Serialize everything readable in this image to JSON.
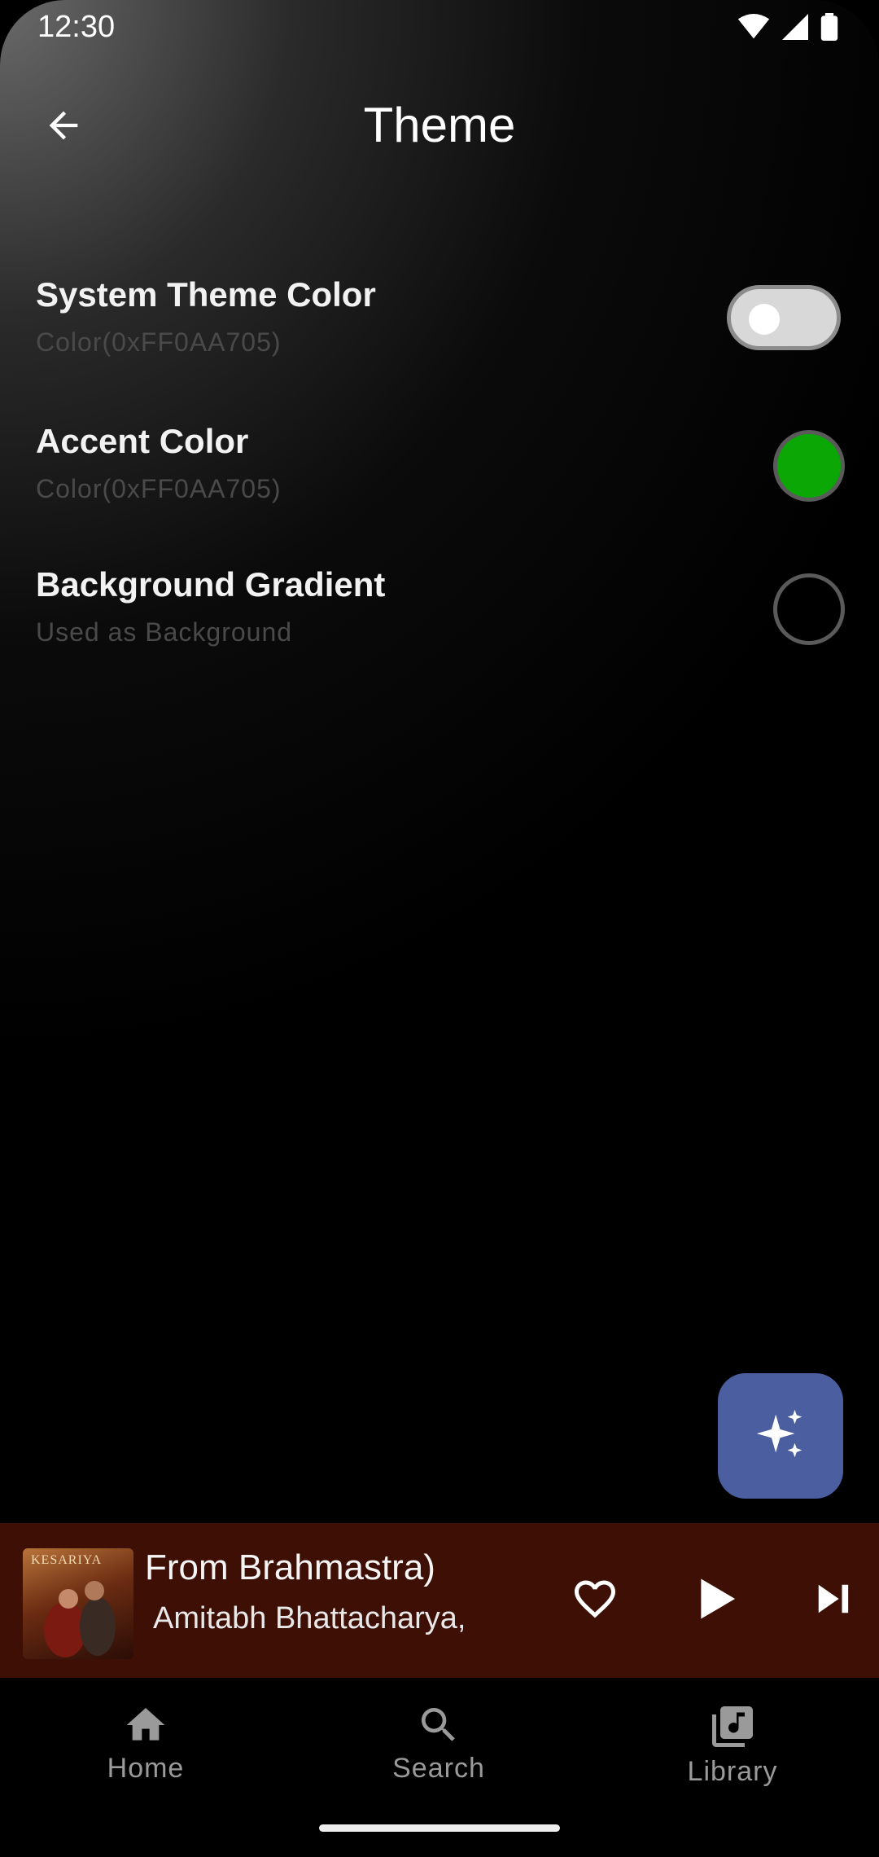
{
  "status_bar": {
    "time": "12:30"
  },
  "header": {
    "title": "Theme"
  },
  "settings": [
    {
      "title": "System Theme Color",
      "subtitle": "Color(0xFF0AA705)",
      "control": "toggle",
      "enabled": false
    },
    {
      "title": "Accent Color",
      "subtitle": "Color(0xFF0AA705)",
      "control": "color-swatch",
      "color": "#0aa705"
    },
    {
      "title": "Background Gradient",
      "subtitle": "Used as Background",
      "control": "color-swatch",
      "color": "transparent"
    }
  ],
  "fab": {
    "icon": "sparkles-icon",
    "color": "#4a5ea0"
  },
  "mini_player": {
    "song_title": "From Brahmastra)",
    "artist": "Amitabh Bhattacharya,",
    "album_art_text": "KESARIYA",
    "background": "#3d0f05"
  },
  "bottom_nav": [
    {
      "label": "Home",
      "icon": "home-icon"
    },
    {
      "label": "Search",
      "icon": "search-icon"
    },
    {
      "label": "Library",
      "icon": "library-music-icon"
    }
  ]
}
